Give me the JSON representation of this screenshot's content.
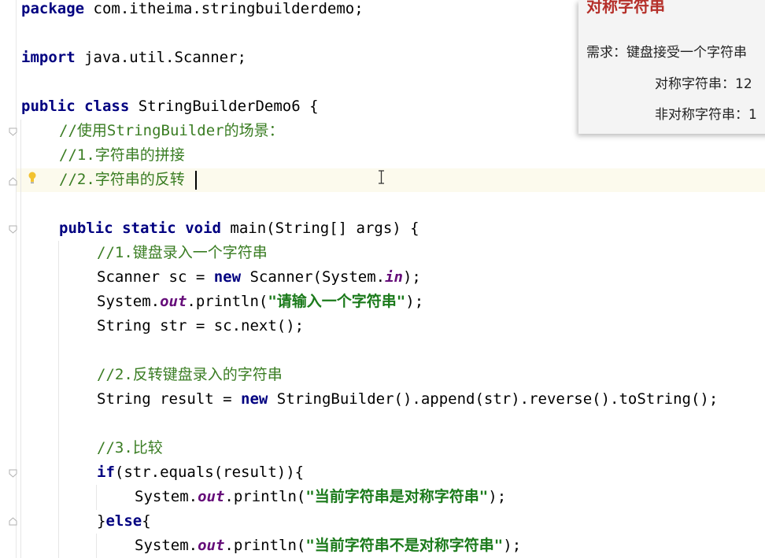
{
  "code": {
    "line1": {
      "kw": "package",
      "rest": " com.itheima.stringbuilderdemo;"
    },
    "line3": {
      "kw": "import",
      "rest": " java.util.Scanner;"
    },
    "line5": {
      "kw1": "public",
      "kw2": "class",
      "rest": " StringBuilderDemo6 {"
    },
    "line6": {
      "comment": "//使用StringBuilder的场景："
    },
    "line7": {
      "comment": "//1.字符串的拼接"
    },
    "line8": {
      "comment": "//2.字符串的反转"
    },
    "line10": {
      "kw1": "public",
      "kw2": "static",
      "kw3": "void",
      "rest": " main(String[] args) {"
    },
    "line11": {
      "comment": "//1.键盘录入一个字符串"
    },
    "line12": {
      "a": "Scanner sc = ",
      "kw": "new",
      "b": " Scanner(System.",
      "fld": "in",
      "c": ");"
    },
    "line13": {
      "a": "System.",
      "fld": "out",
      "b": ".println(",
      "str": "\"请输入一个字符串\"",
      "c": ");"
    },
    "line14": {
      "a": "String str = sc.next();"
    },
    "line16": {
      "comment": "//2.反转键盘录入的字符串"
    },
    "line17": {
      "a": "String result = ",
      "kw": "new",
      "b": " StringBuilder().append(str).reverse().toString();"
    },
    "line19": {
      "comment": "//3.比较"
    },
    "line20": {
      "kw": "if",
      "rest": "(str.equals(result)){"
    },
    "line21": {
      "a": "System.",
      "fld": "out",
      "b": ".println(",
      "str": "\"当前字符串是对称字符串\"",
      "c": ");"
    },
    "line22": {
      "a": "}",
      "kw": "else",
      "b": "{"
    },
    "line23": {
      "a": "System.",
      "fld": "out",
      "b": ".println(",
      "str": "\"当前字符串不是对称字符串\"",
      "c": ");"
    }
  },
  "slide": {
    "title": "对称字符串",
    "requirement": "需求：键盘接受一个字符串",
    "symmetric": "对称字符串：12",
    "asymmetric": "非对称字符串：1"
  },
  "icons": {
    "fold": "fold-marker-icon",
    "intention": "intention-bulb-icon",
    "cursor": "text-cursor-icon"
  },
  "colors": {
    "keyword": "#000080",
    "comment": "#3a7d23",
    "string": "#1b7a1b",
    "field": "#660e7a",
    "slide_title": "#b5302a",
    "current_line": "#fcfaed"
  }
}
